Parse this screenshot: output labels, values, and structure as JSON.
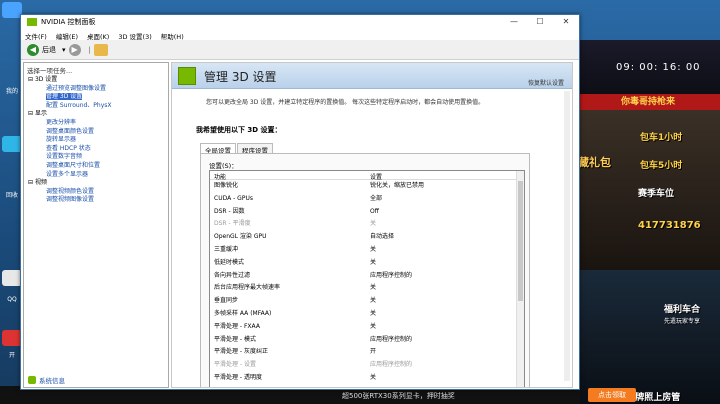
{
  "window": {
    "title": "NVIDIA 控制面板",
    "menu": [
      "文件(F)",
      "编辑(E)",
      "桌面(K)",
      "3D 设置(3)",
      "帮助(H)"
    ],
    "toolbar": {
      "back_label": "后退"
    },
    "controls": {
      "minimize": "—",
      "maximize": "☐",
      "close": "✕"
    }
  },
  "sidebar": {
    "header": "选择一项任务...",
    "footer_link": "系统信息",
    "tree": [
      {
        "label": "3D 设置",
        "kind": "category"
      },
      {
        "label": "通过预览调整图像设置",
        "kind": "item"
      },
      {
        "label": "管理 3D 设置",
        "kind": "item",
        "selected": true
      },
      {
        "label": "配置 Surround、PhysX",
        "kind": "item"
      },
      {
        "label": "显示",
        "kind": "category"
      },
      {
        "label": "更改分辨率",
        "kind": "item"
      },
      {
        "label": "调整桌面颜色设置",
        "kind": "item"
      },
      {
        "label": "旋转显示器",
        "kind": "item"
      },
      {
        "label": "查看 HDCP 状态",
        "kind": "item"
      },
      {
        "label": "设置数字音频",
        "kind": "item"
      },
      {
        "label": "调整桌面尺寸和位置",
        "kind": "item"
      },
      {
        "label": "设置多个显示器",
        "kind": "item"
      },
      {
        "label": "视频",
        "kind": "category"
      },
      {
        "label": "调整视频颜色设置",
        "kind": "item"
      },
      {
        "label": "调整视频图像设置",
        "kind": "item"
      }
    ]
  },
  "main": {
    "title": "管理 3D 设置",
    "restore_defaults": "恢复默认设置",
    "description": "您可以更改全局 3D 设置，并建立特定程序的置换值。 每次这些特定程序启动时，都会自动使用置换值。",
    "lead": "我希望使用以下 3D 设置：",
    "tabs": [
      "全局设置",
      "程序设置"
    ],
    "settings_label": "设置(S)：",
    "col_feature": "功能",
    "col_setting": "设置",
    "rows": [
      {
        "feature": "图像锐化",
        "setting": "锐化关，缩放已禁用",
        "dim": false
      },
      {
        "feature": "CUDA - GPUs",
        "setting": "全部",
        "dim": false
      },
      {
        "feature": "DSR - 因数",
        "setting": "Off",
        "dim": false
      },
      {
        "feature": "DSR - 平滑度",
        "setting": "关",
        "dim": true
      },
      {
        "feature": "OpenGL 渲染 GPU",
        "setting": "自动选择",
        "dim": false
      },
      {
        "feature": "三重缓冲",
        "setting": "关",
        "dim": false
      },
      {
        "feature": "低延时模式",
        "setting": "关",
        "dim": false
      },
      {
        "feature": "各向异性过滤",
        "setting": "应用程序控制的",
        "dim": false
      },
      {
        "feature": "后台应用程序最大帧速率",
        "setting": "关",
        "dim": false
      },
      {
        "feature": "垂直同步",
        "setting": "关",
        "dim": false
      },
      {
        "feature": "多帧采样 AA (MFAA)",
        "setting": "关",
        "dim": false
      },
      {
        "feature": "平滑处理 - FXAA",
        "setting": "关",
        "dim": false
      },
      {
        "feature": "平滑处理 - 模式",
        "setting": "应用程序控制的",
        "dim": false
      },
      {
        "feature": "平滑处理 - 灰度纠正",
        "setting": "开",
        "dim": false
      },
      {
        "feature": "平滑处理 - 设置",
        "setting": "应用程序控制的",
        "dim": true
      },
      {
        "feature": "平滑处理 - 透明度",
        "setting": "关",
        "dim": false
      }
    ]
  },
  "ad": {
    "time": "09: 00: 16: 00",
    "banner": "你毒哥持枪来",
    "lines": [
      "包车1小时",
      "包车5小时",
      "赛季车位"
    ],
    "gift": "藏礼包",
    "number": "417731876",
    "welfare": "福利车合",
    "welfare_sub": "先遣玩家专享",
    "grade": "6级牌照上房管",
    "claim": "点击领取",
    "strip": "超500张RTX30系列显卡，押时抽奖"
  },
  "desktop": {
    "icons": [
      "我的",
      "回收",
      "QQ",
      "开"
    ]
  }
}
